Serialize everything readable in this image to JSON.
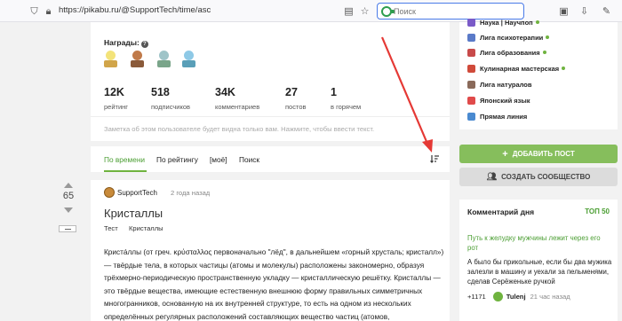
{
  "browser": {
    "url": "https://pikabu.ru/@SupportTech/time/asc",
    "search_placeholder": "Поиск",
    "search_value": ""
  },
  "profile": {
    "awards_label": "Награды:",
    "help_glyph": "?",
    "awards": [
      {
        "name": "award-1",
        "top_color": "#f3e37a",
        "base_color": "#d1a54a"
      },
      {
        "name": "award-2",
        "top_color": "#c07a4a",
        "base_color": "#8a5a3a"
      },
      {
        "name": "award-3",
        "top_color": "#9fc4c8",
        "base_color": "#7aa58a"
      },
      {
        "name": "award-4",
        "top_color": "#8ec9e6",
        "base_color": "#5a9fb8"
      }
    ],
    "stats": [
      {
        "value": "12K",
        "label": "рейтинг"
      },
      {
        "value": "518",
        "label": "подписчиков"
      },
      {
        "value": "34K",
        "label": "комментариев"
      },
      {
        "value": "27",
        "label": "постов"
      },
      {
        "value": "1",
        "label": "в горячем"
      }
    ]
  },
  "note": {
    "text": "Заметка об этом пользователе будет видна только вам. Нажмите, чтобы ввести текст."
  },
  "tabs": [
    {
      "label": "По времени",
      "active": true
    },
    {
      "label": "По рейтингу",
      "active": false
    },
    {
      "label": "[моё]",
      "active": false
    },
    {
      "label": "Поиск",
      "active": false
    }
  ],
  "post": {
    "author": "SupportTech",
    "time": "2 года назад",
    "title": "Кристаллы",
    "tags": [
      "Тест",
      "Кристаллы"
    ],
    "body": "Кристáллы (от греч. κρύσταλλος первоначально \"лёд\", в дальнейшем «горный хрусталь; кристалл») — твёрдые тела, в которых частицы (атомы и молекулы) расположены закономерно, образуя трёхмерно-периодическую пространственную укладку — кристаллическую решётку. Кристаллы — это твёрдые вещества, имеющие естественную внешнюю форму правильных симметричных многогранников, основанную на их внутренней структуре, то есть на одном из нескольких определённых регулярных расположений составляющих вещество частиц (атомов,",
    "votes": "65"
  },
  "communities": [
    {
      "label": "Наука | Научпоп",
      "color": "#7a5ac8",
      "online": true
    },
    {
      "label": "Лига психотерапии",
      "color": "#5a7ac8",
      "online": true
    },
    {
      "label": "Лига образования",
      "color": "#c84a4a",
      "online": true
    },
    {
      "label": "Кулинарная мастерская",
      "color": "#d04a3a",
      "online": true
    },
    {
      "label": "Лига натуралов",
      "color": "#8a6a5a",
      "online": false
    },
    {
      "label": "Японский язык",
      "color": "#e04a4a",
      "online": false
    },
    {
      "label": "Прямая линия",
      "color": "#4a8ad0",
      "online": false
    }
  ],
  "sidebar": {
    "add_post": "ДОБАВИТЬ ПОСТ",
    "create_community": "СОЗДАТЬ СООБЩЕСТВО"
  },
  "comment_of_day": {
    "title": "Комментарий дня",
    "badge": "ТОП 50",
    "link": "Путь к желудку мужчины лежит через его рот",
    "text": "А было бы прикольные, если бы два мужика залезли в машину и уехали за пельменями, сделав Серёженьке ручкой",
    "rating": "+1171",
    "user": "Tulenj",
    "time": "21 час назад"
  },
  "colors": {
    "accent_green": "#6fb33f",
    "annotation_red": "#e53935"
  }
}
